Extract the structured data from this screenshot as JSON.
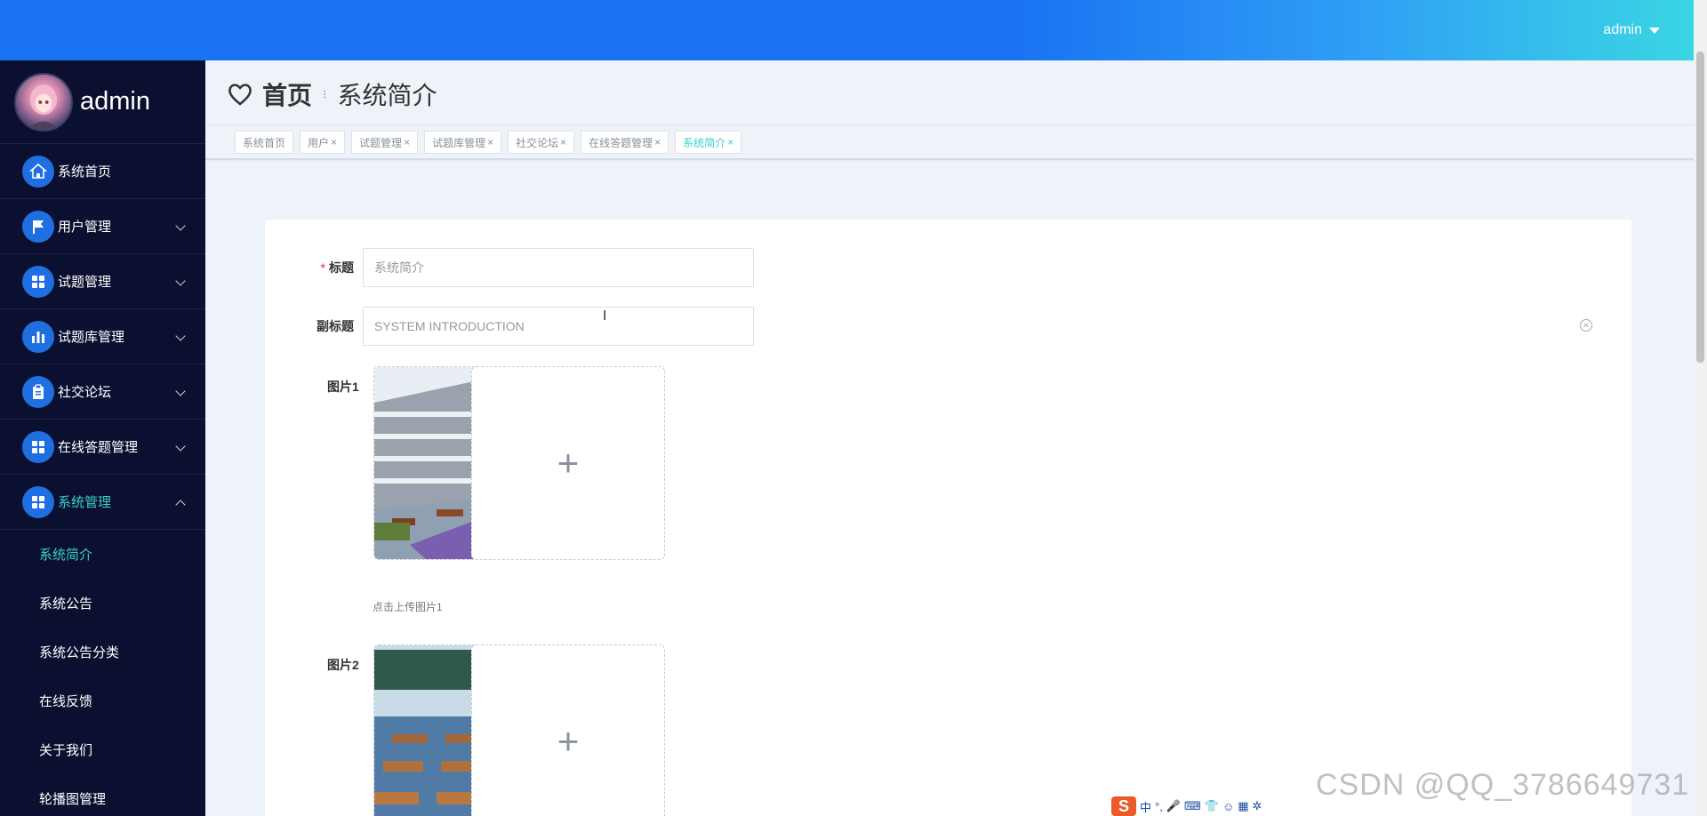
{
  "header": {
    "user": "admin"
  },
  "sidebar": {
    "brand": "admin",
    "items": [
      {
        "label": "系统首页"
      },
      {
        "label": "用户管理"
      },
      {
        "label": "试题管理"
      },
      {
        "label": "试题库管理"
      },
      {
        "label": "社交论坛"
      },
      {
        "label": "在线答题管理"
      },
      {
        "label": "系统管理"
      }
    ],
    "sub_items": [
      {
        "label": "系统简介"
      },
      {
        "label": "系统公告"
      },
      {
        "label": "系统公告分类"
      },
      {
        "label": "在线反馈"
      },
      {
        "label": "关于我们"
      },
      {
        "label": "轮播图管理"
      }
    ]
  },
  "breadcrumb": {
    "home": "首页",
    "current": "系统简介"
  },
  "tags": [
    {
      "label": "系统首页",
      "closable": false
    },
    {
      "label": "用户",
      "closable": true
    },
    {
      "label": "试题管理",
      "closable": true
    },
    {
      "label": "试题库管理",
      "closable": true
    },
    {
      "label": "社交论坛",
      "closable": true
    },
    {
      "label": "在线答题管理",
      "closable": true
    },
    {
      "label": "系统简介",
      "closable": true
    }
  ],
  "tag_close": "×",
  "form": {
    "title_label": "标题",
    "required_mark": "*",
    "title_placeholder": "系统简介",
    "subtitle_label": "副标题",
    "subtitle_placeholder": "SYSTEM INTRODUCTION",
    "image1_label": "图片1",
    "image1_hint": "点击上传图片1",
    "image2_label": "图片2",
    "plus": "+"
  },
  "ime": {
    "chars": [
      "中",
      "°,",
      "🎤",
      "⌨",
      "👕",
      "☺",
      "▦",
      "✲"
    ]
  },
  "watermark": "CSDN @QQ_3786649731",
  "colors": {
    "accent": "#3ad1c8",
    "primary": "#1a73f2",
    "sidebar": "#0c1030"
  }
}
